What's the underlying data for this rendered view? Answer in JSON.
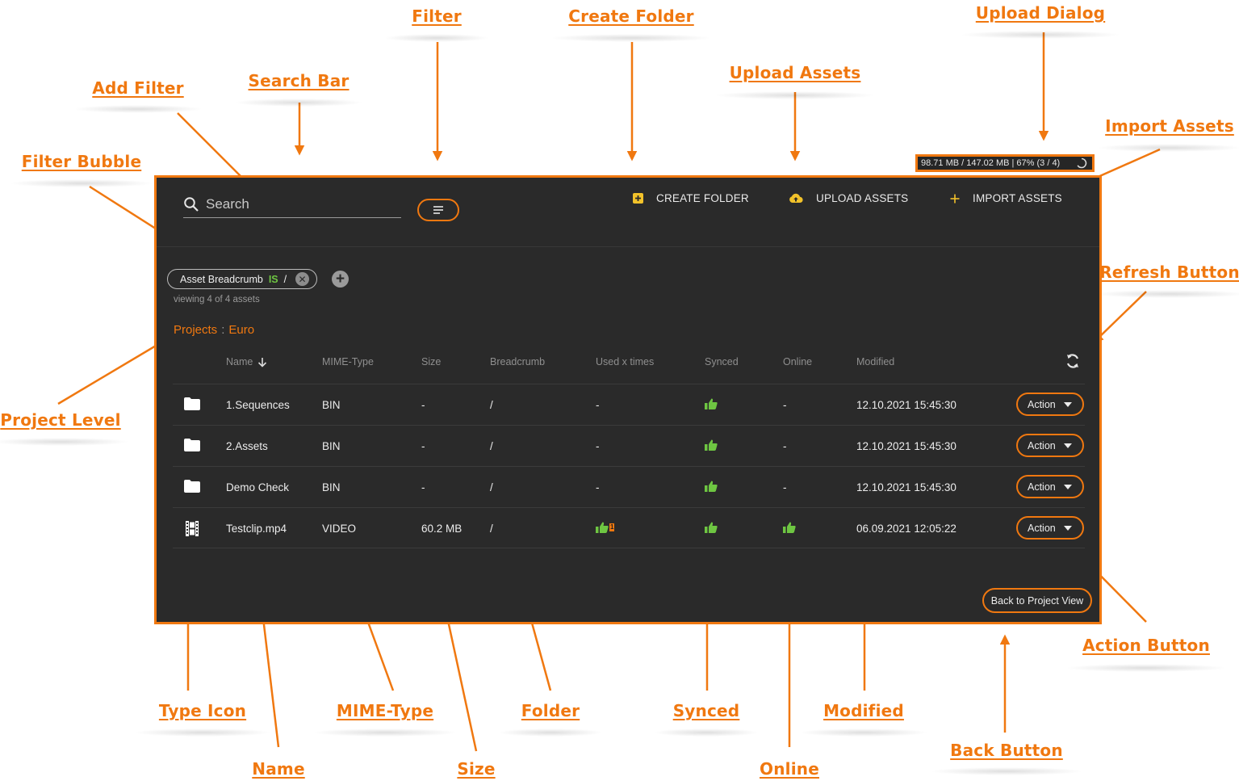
{
  "annotations": {
    "filter": "Filter",
    "create_folder": "Create Folder",
    "upload_dialog": "Upload Dialog",
    "add_filter": "Add Filter",
    "search_bar": "Search Bar",
    "upload_assets": "Upload Assets",
    "import_assets": "Import Assets",
    "filter_bubble": "Filter Bubble",
    "refresh_button": "Refresh Button",
    "project_level": "Project Level",
    "action_button": "Action Button",
    "type_icon": "Type Icon",
    "mime_type": "MIME-Type",
    "folder": "Folder",
    "synced": "Synced",
    "modified": "Modified",
    "back_button": "Back Button",
    "name": "Name",
    "size": "Size",
    "online": "Online"
  },
  "upload_dialog": {
    "status": "98.71 MB / 147.02 MB | 67% (3 / 4)",
    "progress_percent": 67
  },
  "toolbar": {
    "search_placeholder": "Search",
    "filter_icon": "filter-lines-icon",
    "create_folder": "CREATE FOLDER",
    "upload_assets": "UPLOAD ASSETS",
    "import_assets": "IMPORT ASSETS"
  },
  "filter_chip": {
    "field": "Asset Breadcrumb",
    "operator": "IS",
    "value": "/",
    "remove_icon": "close-circle-icon"
  },
  "add_filter_icon": "plus-circle-icon",
  "viewing": "viewing 4 of 4 assets",
  "breadcrumb": {
    "root": "Projects",
    "separator": ":",
    "current": "Euro"
  },
  "table": {
    "columns": {
      "name": "Name",
      "mime": "MIME-Type",
      "size": "Size",
      "breadcrumb": "Breadcrumb",
      "used": "Used x times",
      "synced": "Synced",
      "online": "Online",
      "modified": "Modified"
    },
    "sort_icon": "arrow-down-icon",
    "refresh_icon": "refresh-icon",
    "rows": [
      {
        "type": "folder",
        "name": "1.Sequences",
        "mime": "BIN",
        "size": "-",
        "breadcrumb": "/",
        "used": "-",
        "synced": "thumbs-up",
        "online": "-",
        "modified": "12.10.2021 15:45:30",
        "action": "Action"
      },
      {
        "type": "folder",
        "name": "2.Assets",
        "mime": "BIN",
        "size": "-",
        "breadcrumb": "/",
        "used": "-",
        "synced": "thumbs-up",
        "online": "-",
        "modified": "12.10.2021 15:45:30",
        "action": "Action"
      },
      {
        "type": "folder",
        "name": "Demo Check",
        "mime": "BIN",
        "size": "-",
        "breadcrumb": "/",
        "used": "-",
        "synced": "thumbs-up",
        "online": "-",
        "modified": "12.10.2021 15:45:30",
        "action": "Action"
      },
      {
        "type": "video",
        "name": "Testclip.mp4",
        "mime": "VIDEO",
        "size": "60.2 MB",
        "breadcrumb": "/",
        "used": "thumbs-up",
        "used_count": "1",
        "synced": "thumbs-up",
        "online": "thumbs-up",
        "modified": "06.09.2021 12:05:22",
        "action": "Action"
      }
    ]
  },
  "back_button": "Back to Project View",
  "colors": {
    "accent": "#f07810",
    "panel": "#2a2a2a",
    "success": "#6ec642"
  }
}
